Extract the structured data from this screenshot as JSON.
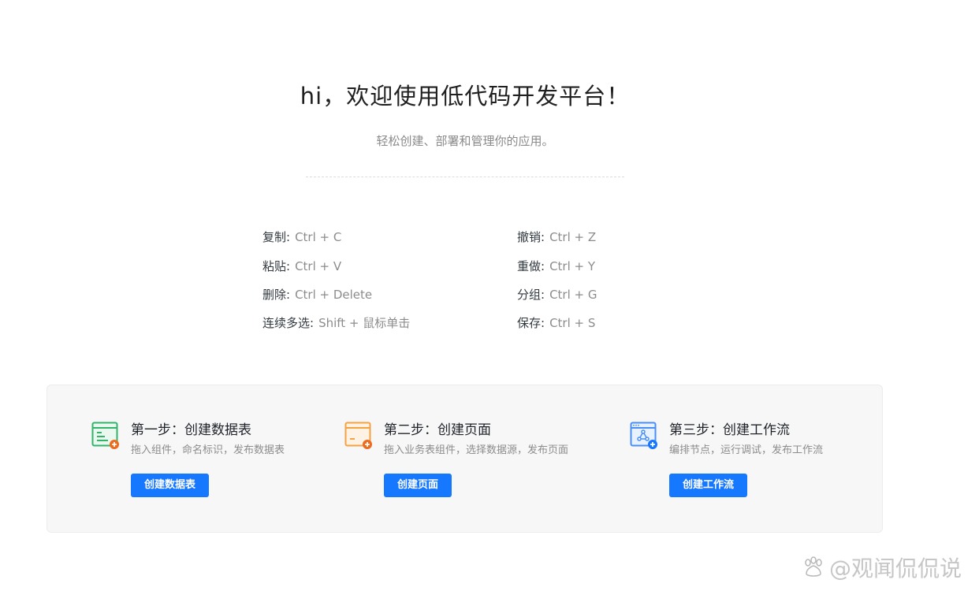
{
  "welcome": {
    "title": "hi，欢迎使用低代码开发平台！",
    "subtitle": "轻松创建、部署和管理你的应用。"
  },
  "shortcuts": [
    {
      "key": "复制:",
      "value": "Ctrl + C"
    },
    {
      "key": "粘贴:",
      "value": "Ctrl + V"
    },
    {
      "key": "删除:",
      "value": "Ctrl + Delete"
    },
    {
      "key": "连续多选:",
      "value": "Shift + 鼠标单击"
    },
    {
      "key": "撤销:",
      "value": "Ctrl + Z"
    },
    {
      "key": "重做:",
      "value": "Ctrl + Y"
    },
    {
      "key": "分组:",
      "value": "Ctrl + G"
    },
    {
      "key": "保存:",
      "value": "Ctrl + S"
    }
  ],
  "steps": [
    {
      "icon": "table-add-icon",
      "color": "#34b36b",
      "title": "第一步：创建数据表",
      "desc": "拖入组件，命名标识，发布数据表",
      "button": "创建数据表"
    },
    {
      "icon": "page-add-icon",
      "color": "#f5a243",
      "title": "第二步：创建页面",
      "desc": "拖入业务表组件，选择数据源，发布页面",
      "button": "创建页面"
    },
    {
      "icon": "workflow-add-icon",
      "color": "#4a8ff5",
      "title": "第三步：创建工作流",
      "desc": "编排节点，运行调试，发布工作流",
      "button": "创建工作流"
    }
  ],
  "colors": {
    "primary": "#1677ff",
    "badge_orange": "#ee6a1e",
    "badge_blue": "#1677ff"
  },
  "watermark": {
    "text": "@观闻侃侃说",
    "icon": "baidu-paw-icon"
  }
}
